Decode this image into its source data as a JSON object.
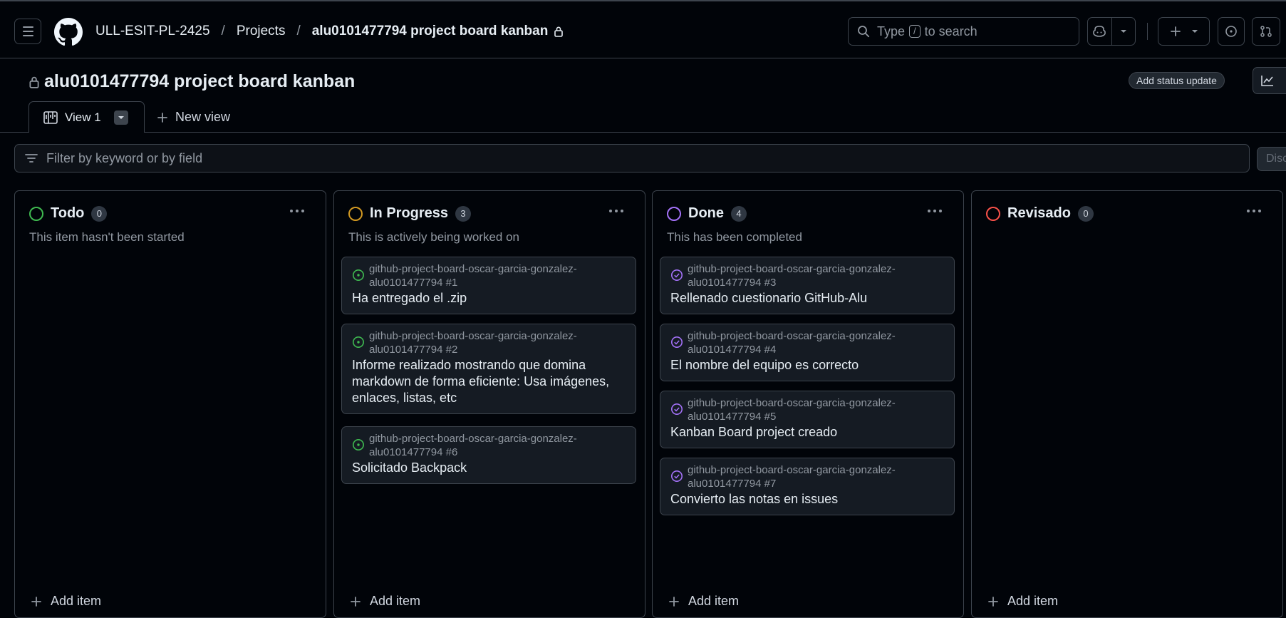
{
  "topbar": {
    "org": "ULL-ESIT-PL-2425",
    "projects": "Projects",
    "project": "alu0101477794 project board kanban",
    "search_prefix": "Type",
    "search_key": "/",
    "search_suffix": "to search"
  },
  "page": {
    "title": "alu0101477794 project board kanban",
    "status_update": "Add status update",
    "tab_view": "View 1",
    "new_view": "New view",
    "filter_placeholder": "Filter by keyword or by field",
    "discard": "Disc"
  },
  "columns": [
    {
      "name": "Todo",
      "count": "0",
      "color": "#3fb950",
      "description": "This item hasn't been started",
      "add": "Add item",
      "cards": []
    },
    {
      "name": "In Progress",
      "count": "3",
      "color": "#d29922",
      "description": "This is actively being worked on",
      "add": "Add item",
      "cards": [
        {
          "repo": "github-project-board-oscar-garcia-gonzalez-",
          "ref": "alu0101477794 #1",
          "title": "Ha entregado el .zip",
          "state": "open"
        },
        {
          "repo": "github-project-board-oscar-garcia-gonzalez-",
          "ref": "alu0101477794 #2",
          "title": "Informe realizado mostrando que domina markdown de forma eficiente: Usa imágenes, enlaces, listas, etc",
          "state": "open"
        },
        {
          "repo": "github-project-board-oscar-garcia-gonzalez-",
          "ref": "alu0101477794 #6",
          "title": "Solicitado Backpack",
          "state": "open"
        }
      ]
    },
    {
      "name": "Done",
      "count": "4",
      "color": "#a371f7",
      "description": "This has been completed",
      "add": "Add item",
      "cards": [
        {
          "repo": "github-project-board-oscar-garcia-gonzalez-",
          "ref": "alu0101477794 #3",
          "title": "Rellenado cuestionario GitHub-Alu",
          "state": "closed"
        },
        {
          "repo": "github-project-board-oscar-garcia-gonzalez-",
          "ref": "alu0101477794 #4",
          "title": "El nombre del equipo es correcto",
          "state": "closed"
        },
        {
          "repo": "github-project-board-oscar-garcia-gonzalez-",
          "ref": "alu0101477794 #5",
          "title": "Kanban Board project creado",
          "state": "closed"
        },
        {
          "repo": "github-project-board-oscar-garcia-gonzalez-",
          "ref": "alu0101477794 #7",
          "title": "Convierto las notas en issues",
          "state": "closed"
        }
      ]
    },
    {
      "name": "Revisado",
      "count": "0",
      "color": "#f85149",
      "description": "",
      "add": "Add item",
      "cards": []
    }
  ]
}
